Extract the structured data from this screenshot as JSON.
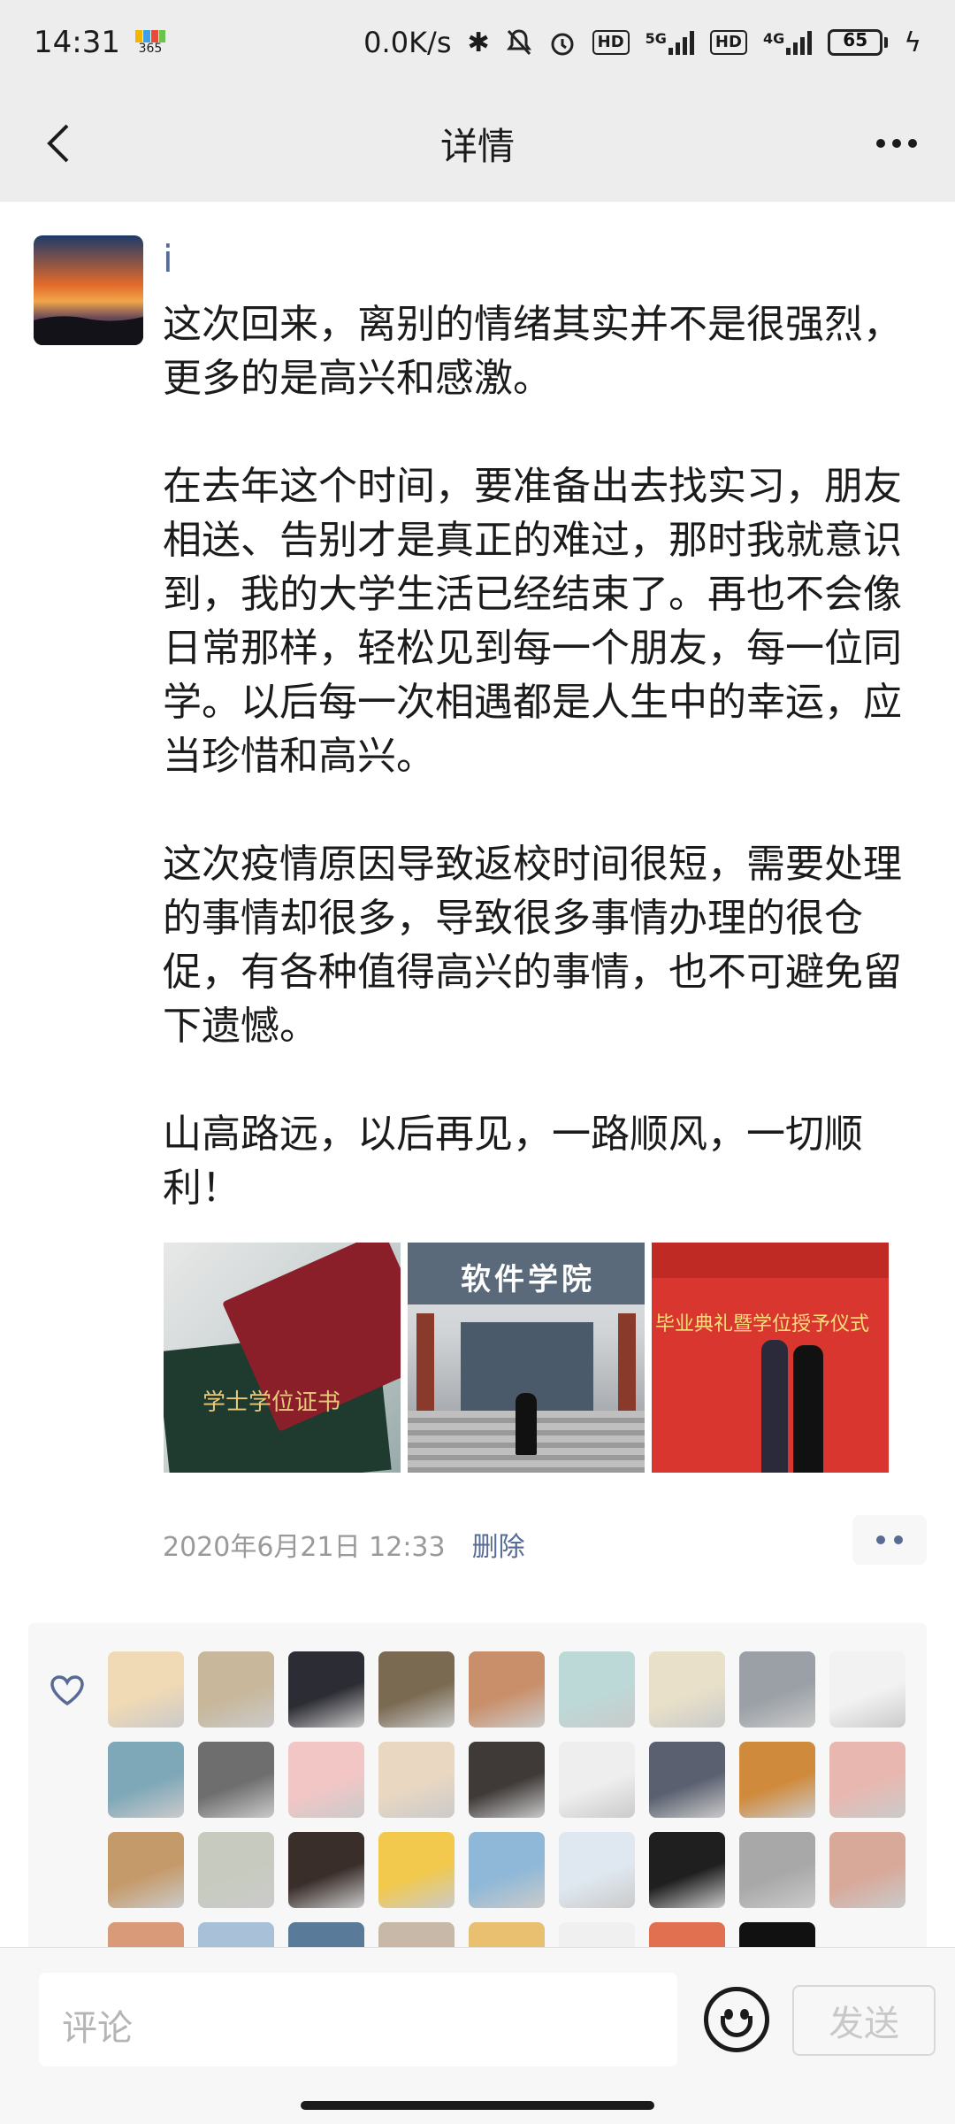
{
  "status_bar": {
    "time": "14:31",
    "app_badge": "365",
    "net_speed": "0.0K/s",
    "net_5g": "5G",
    "net_4g": "4G",
    "hd1": "HD",
    "hd2": "HD",
    "battery": "65"
  },
  "nav": {
    "title": "详情"
  },
  "post": {
    "author": "i",
    "text": "这次回来，离别的情绪其实并不是很强烈，更多的是高兴和感激。\n\n在去年这个时间，要准备出去找实习，朋友相送、告别才是真正的难过，那时我就意识到，我的大学生活已经结束了。再也不会像日常那样，轻松见到每一个朋友，每一位同学。以后每一次相遇都是人生中的幸运，应当珍惜和高兴。\n\n这次疫情原因导致返校时间很短，需要处理的事情却很多，导致很多事情办理的很仓促，有各种值得高兴的事情，也不可避免留下遗憾。\n\n山高路远，以后再见，一路顺风，一切顺利！",
    "photo1_text": "学士学位证书",
    "photo2_text": "软件学院",
    "photo3_text": "毕业典礼暨学位授予仪式",
    "timestamp": "2020年6月21日 12:33",
    "delete_label": "删除"
  },
  "likes": {
    "avatar_colors": [
      "#f0d9b5",
      "#c8b79a",
      "#2c2c34",
      "#7a6a52",
      "#c98f6a",
      "#bcd9d8",
      "#e8e0c8",
      "#9aa0a6",
      "#f2f2f2",
      "#7ea7b8",
      "#6e6e6e",
      "#f3c6c6",
      "#e9d7c2",
      "#3f3a38",
      "#eeeeee",
      "#5a6070",
      "#d08a3c",
      "#e8b8b0",
      "#c59a6a",
      "#c7cbbf",
      "#3a2e2a",
      "#f2c94c",
      "#8fb8d8",
      "#dfe8f0",
      "#1f1f1f",
      "#a8a8a8",
      "#d8a898",
      "#d99a7a",
      "#a8c0d8",
      "#5a7a9a",
      "#c8b8a8",
      "#e8c070",
      "#f0f0f0",
      "#e07050",
      "#111111"
    ]
  },
  "comment_bar": {
    "placeholder": "评论",
    "send_label": "发送"
  },
  "icons": {
    "back": "chevron-left-icon",
    "more": "more-icon",
    "heart": "heart-icon",
    "emoji": "emoji-icon"
  }
}
